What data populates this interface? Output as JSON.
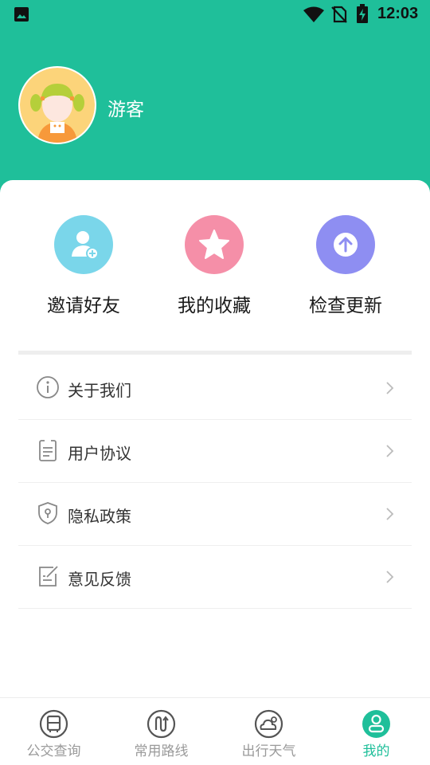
{
  "status_bar": {
    "time": "12:03",
    "icons": [
      "image-icon",
      "wifi-icon",
      "no-sim-icon",
      "battery-charging-icon"
    ]
  },
  "profile": {
    "name": "游客",
    "avatar": "girl-avatar"
  },
  "quick_actions": [
    {
      "label": "邀请好友",
      "icon": "add-user-icon",
      "color": "#7ad6ea"
    },
    {
      "label": "我的收藏",
      "icon": "star-icon",
      "color": "#f58fa8"
    },
    {
      "label": "检查更新",
      "icon": "arrow-up-icon",
      "color": "#8e8ef2"
    }
  ],
  "menu": [
    {
      "label": "关于我们",
      "icon": "info-icon"
    },
    {
      "label": "用户协议",
      "icon": "document-icon"
    },
    {
      "label": "隐私政策",
      "icon": "shield-lock-icon"
    },
    {
      "label": "意见反馈",
      "icon": "edit-note-icon"
    }
  ],
  "tabs": [
    {
      "label": "公交查询",
      "icon": "bus-icon",
      "active": false
    },
    {
      "label": "常用路线",
      "icon": "route-icon",
      "active": false
    },
    {
      "label": "出行天气",
      "icon": "weather-icon",
      "active": false
    },
    {
      "label": "我的",
      "icon": "user-icon",
      "active": true
    }
  ],
  "colors": {
    "brand": "#1fbf9a",
    "inactive_tab": "#9a9a9a"
  }
}
